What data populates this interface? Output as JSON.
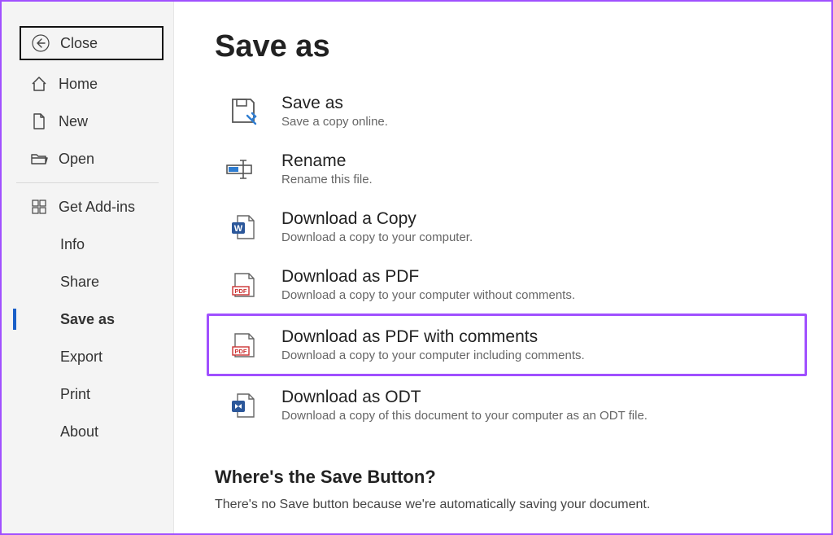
{
  "sidebar": {
    "close": "Close",
    "home": "Home",
    "new": "New",
    "open": "Open",
    "addins": "Get Add-ins",
    "info": "Info",
    "share": "Share",
    "saveas": "Save as",
    "export": "Export",
    "print": "Print",
    "about": "About"
  },
  "page": {
    "title": "Save as"
  },
  "options": {
    "saveas": {
      "title": "Save as",
      "desc": "Save a copy online."
    },
    "rename": {
      "title": "Rename",
      "desc": "Rename this file."
    },
    "downloadcopy": {
      "title": "Download a Copy",
      "desc": "Download a copy to your computer."
    },
    "downloadpdf": {
      "title": "Download as PDF",
      "desc": "Download a copy to your computer without comments."
    },
    "downloadpdfcomments": {
      "title": "Download as PDF with comments",
      "desc": "Download a copy to your computer including comments."
    },
    "downloadodt": {
      "title": "Download as ODT",
      "desc": "Download a copy of this document to your computer as an ODT file."
    }
  },
  "info": {
    "title": "Where's the Save Button?",
    "text": "There's no Save button because we're automatically saving your document."
  }
}
